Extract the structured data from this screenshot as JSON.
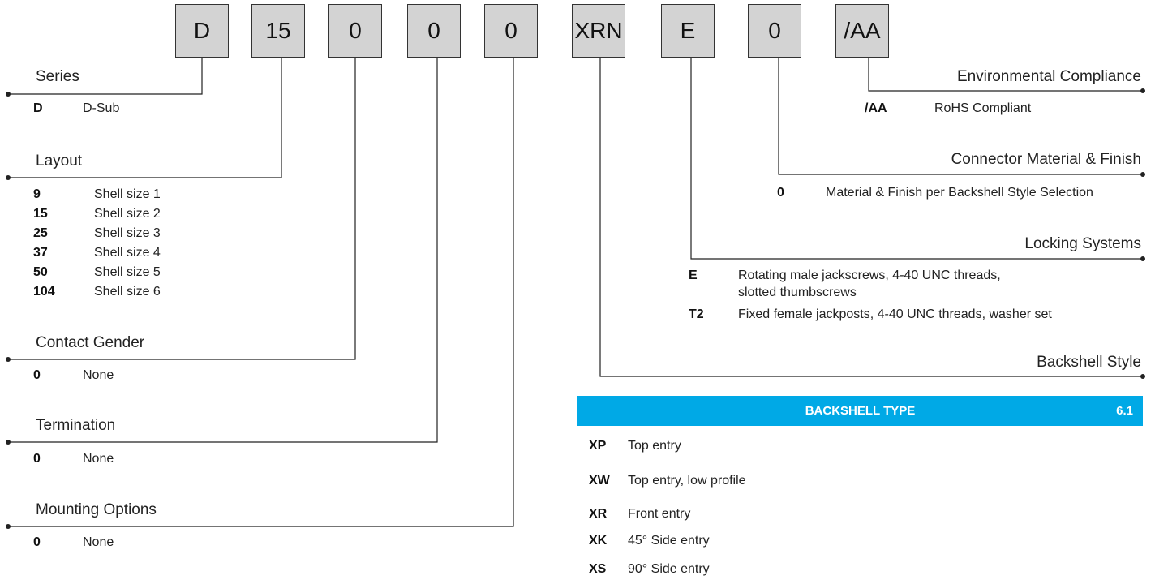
{
  "part_boxes": [
    "D",
    "15",
    "0",
    "0",
    "0",
    "XRN",
    "E",
    "0",
    "/AA"
  ],
  "left_groups": [
    {
      "heading": "Series",
      "options": [
        {
          "code": "D",
          "desc": "D-Sub"
        }
      ]
    },
    {
      "heading": "Layout",
      "options": [
        {
          "code": "9",
          "desc": "Shell size 1"
        },
        {
          "code": "15",
          "desc": "Shell size 2"
        },
        {
          "code": "25",
          "desc": "Shell size 3"
        },
        {
          "code": "37",
          "desc": "Shell size 4"
        },
        {
          "code": "50",
          "desc": "Shell size 5"
        },
        {
          "code": "104",
          "desc": "Shell size 6"
        }
      ]
    },
    {
      "heading": "Contact Gender",
      "options": [
        {
          "code": "0",
          "desc": "None"
        }
      ]
    },
    {
      "heading": "Termination",
      "options": [
        {
          "code": "0",
          "desc": "None"
        }
      ]
    },
    {
      "heading": "Mounting Options",
      "options": [
        {
          "code": "0",
          "desc": "None"
        }
      ]
    }
  ],
  "right_groups": [
    {
      "heading": "Environmental Compliance",
      "options": [
        {
          "code": "/AA",
          "desc": "RoHS Compliant"
        }
      ]
    },
    {
      "heading": "Connector Material & Finish",
      "options": [
        {
          "code": "0",
          "desc": "Material & Finish per Backshell Style Selection"
        }
      ]
    },
    {
      "heading": "Locking Systems",
      "options": [
        {
          "code": "E",
          "desc": "Rotating male jackscrews, 4-40 UNC threads,",
          "desc2": "slotted thumbscrews"
        },
        {
          "code": "T2",
          "desc": "Fixed female jackposts, 4-40 UNC threads, washer set"
        }
      ]
    },
    {
      "heading": "Backshell Style",
      "options": []
    }
  ],
  "backshell_table": {
    "title": "BACKSHELL TYPE",
    "section": "6.1",
    "header_color": "#00a9e6",
    "rows": [
      {
        "code": "XP",
        "desc": "Top entry"
      },
      {
        "code": "XW",
        "desc": "Top entry, low profile"
      },
      {
        "code": "XR",
        "desc": "Front entry"
      },
      {
        "code": "XK",
        "desc": "45° Side entry"
      },
      {
        "code": "XS",
        "desc": "90°  Side entry"
      }
    ]
  }
}
